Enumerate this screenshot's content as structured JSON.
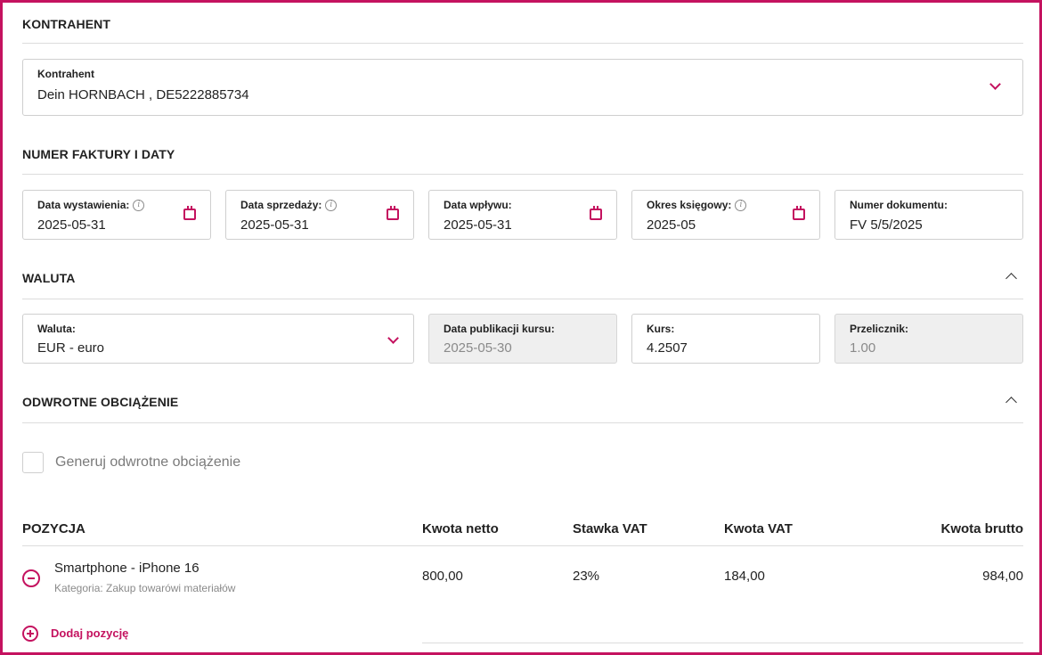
{
  "contractor": {
    "section_title": "KONTRAHENT",
    "field_label": "Kontrahent",
    "field_value": "Dein HORNBACH , DE5222885734"
  },
  "dates": {
    "section_title": "NUMER FAKTURY I DATY",
    "issue_date": {
      "label": "Data wystawienia:",
      "value": "2025-05-31"
    },
    "sale_date": {
      "label": "Data sprzedaży:",
      "value": "2025-05-31"
    },
    "receipt_date": {
      "label": "Data wpływu:",
      "value": "2025-05-31"
    },
    "accounting_period": {
      "label": "Okres księgowy:",
      "value": "2025-05"
    },
    "document_number": {
      "label": "Numer dokumentu:",
      "value": "FV 5/5/2025"
    }
  },
  "currency": {
    "section_title": "WALUTA",
    "currency": {
      "label": "Waluta:",
      "value": "EUR - euro"
    },
    "rate_date": {
      "label": "Data publikacji kursu:",
      "value": "2025-05-30"
    },
    "rate": {
      "label": "Kurs:",
      "value": "4.2507"
    },
    "converter": {
      "label": "Przelicznik:",
      "value": "1.00"
    }
  },
  "reverse_charge": {
    "section_title": "ODWROTNE OBCIĄŻENIE",
    "checkbox_label": "Generuj odwrotne obciążenie",
    "checked": false
  },
  "items": {
    "headers": {
      "position": "POZYCJA",
      "net": "Kwota netto",
      "vat_rate": "Stawka VAT",
      "vat_amount": "Kwota VAT",
      "gross": "Kwota brutto"
    },
    "rows": [
      {
        "name": "Smartphone - iPhone 16",
        "category": "Kategoria: Zakup towarówi materiałów",
        "net": "800,00",
        "vat_rate": "23%",
        "vat_amount": "184,00",
        "gross": "984,00"
      }
    ],
    "add_label": "Dodaj pozycję"
  },
  "colors": {
    "accent": "#c4125f",
    "border": "#cfcfcf",
    "disabled_bg": "#efefef"
  }
}
